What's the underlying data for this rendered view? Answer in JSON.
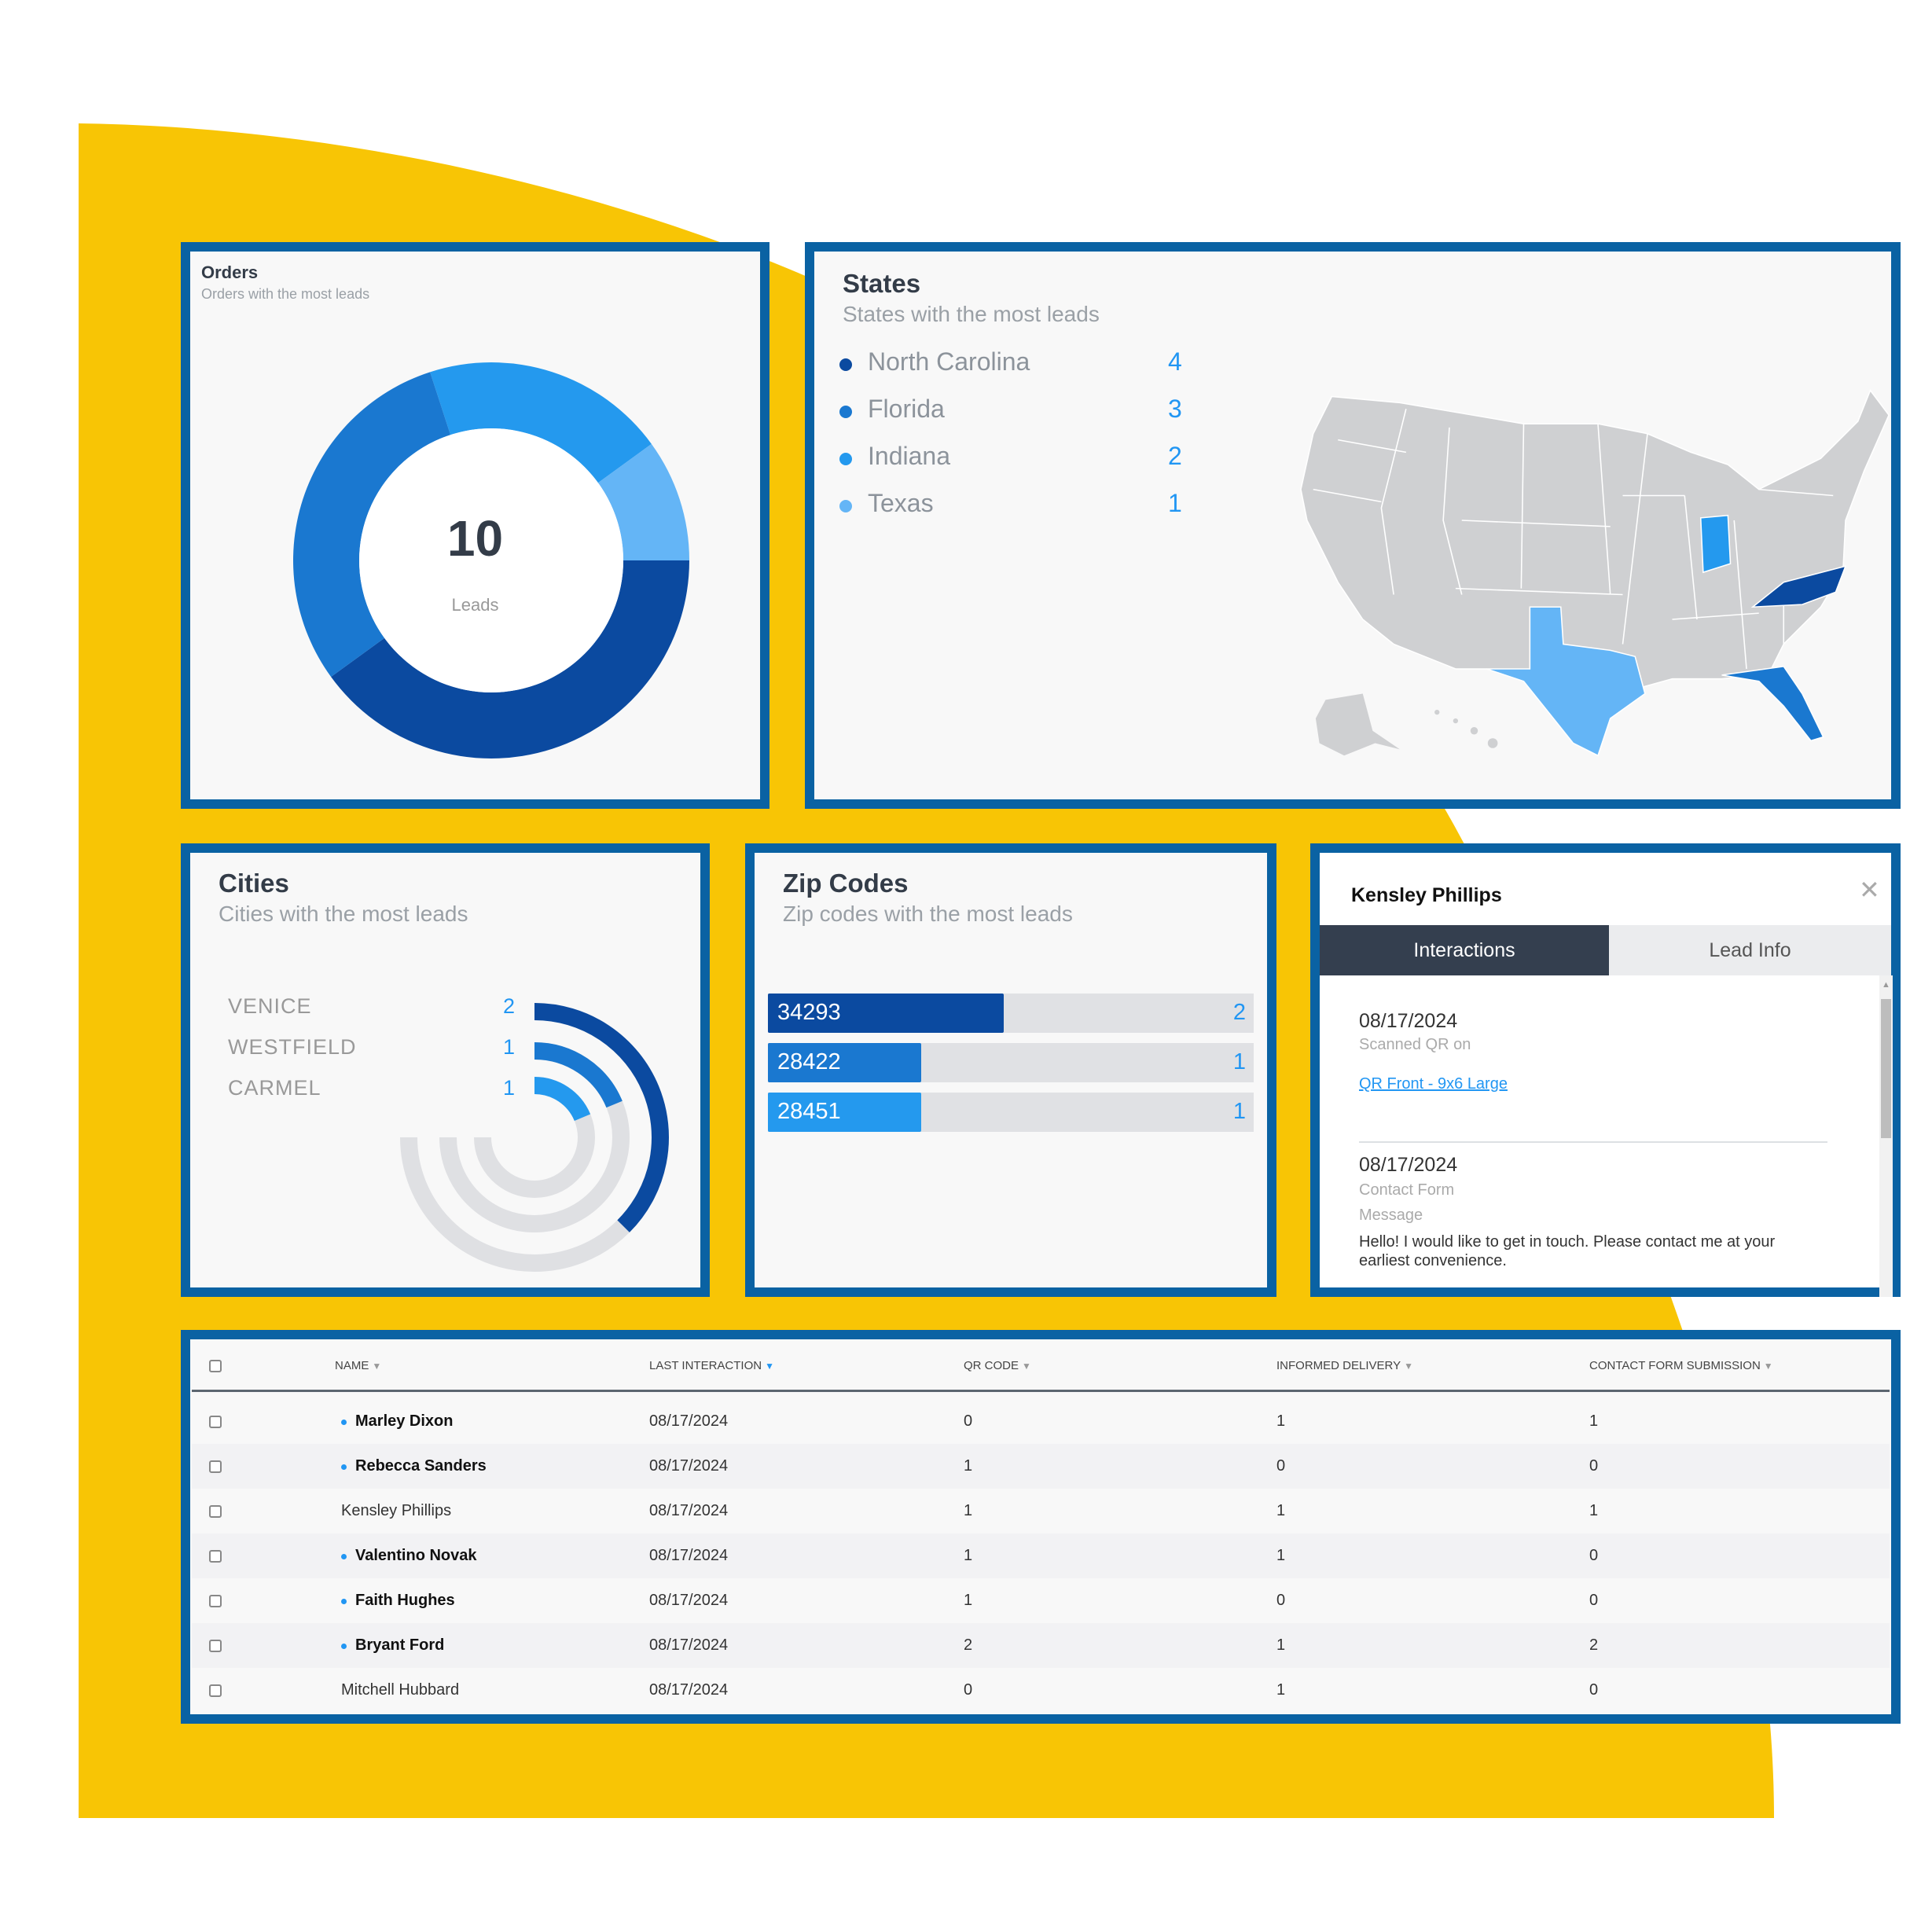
{
  "colors": {
    "border": "#0a62a3",
    "yellow": "#f8c505",
    "dark": "#0b4aa0",
    "mid": "#1a78d0",
    "bright": "#2499ee",
    "light": "#64b5f6",
    "gray": "#cfd0d2"
  },
  "orders": {
    "title": "Orders",
    "subtitle": "Orders with the most leads",
    "total": "10",
    "total_label": "Leads"
  },
  "states": {
    "title": "States",
    "subtitle": "States with the most leads",
    "items": [
      {
        "name": "North Carolina",
        "value": "4",
        "color": "#0b4aa0"
      },
      {
        "name": "Florida",
        "value": "3",
        "color": "#1a78d0"
      },
      {
        "name": "Indiana",
        "value": "2",
        "color": "#2499ee"
      },
      {
        "name": "Texas",
        "value": "1",
        "color": "#64b5f6"
      }
    ]
  },
  "cities": {
    "title": "Cities",
    "subtitle": "Cities with the most leads",
    "items": [
      {
        "name": "VENICE",
        "value": "2"
      },
      {
        "name": "WESTFIELD",
        "value": "1"
      },
      {
        "name": "CARMEL",
        "value": "1"
      }
    ]
  },
  "zips": {
    "title": "Zip Codes",
    "subtitle": "Zip codes with the most leads",
    "items": [
      {
        "code": "34293",
        "value": "2",
        "color": "#0b4aa0"
      },
      {
        "code": "28422",
        "value": "1",
        "color": "#1a78d0"
      },
      {
        "code": "28451",
        "value": "1",
        "color": "#2499ee"
      }
    ]
  },
  "lead": {
    "name": "Kensley Phillips",
    "close_icon": "close-icon",
    "tabs": [
      "Interactions",
      "Lead Info"
    ],
    "interactions": [
      {
        "date": "08/17/2024",
        "type": "Scanned QR on",
        "link": "QR Front - 9x6 Large"
      },
      {
        "date": "08/17/2024",
        "type": "Contact Form",
        "label": "Message",
        "message": "Hello! I would like to get in touch. Please contact me at your earliest convenience."
      }
    ]
  },
  "table": {
    "headers": [
      "NAME",
      "LAST INTERACTION",
      "QR CODE",
      "INFORMED DELIVERY",
      "CONTACT FORM SUBMISSION"
    ],
    "rows": [
      {
        "name": "Marley Dixon",
        "unread": true,
        "last": "08/17/2024",
        "qr": "0",
        "informed": "1",
        "contact": "1"
      },
      {
        "name": "Rebecca Sanders",
        "unread": true,
        "last": "08/17/2024",
        "qr": "1",
        "informed": "0",
        "contact": "0"
      },
      {
        "name": "Kensley Phillips",
        "unread": false,
        "last": "08/17/2024",
        "qr": "1",
        "informed": "1",
        "contact": "1"
      },
      {
        "name": "Valentino Novak",
        "unread": true,
        "last": "08/17/2024",
        "qr": "1",
        "informed": "1",
        "contact": "0"
      },
      {
        "name": "Faith Hughes",
        "unread": true,
        "last": "08/17/2024",
        "qr": "1",
        "informed": "0",
        "contact": "0"
      },
      {
        "name": "Bryant Ford",
        "unread": true,
        "last": "08/17/2024",
        "qr": "2",
        "informed": "1",
        "contact": "2"
      },
      {
        "name": "Mitchell Hubbard",
        "unread": false,
        "last": "08/17/2024",
        "qr": "0",
        "informed": "1",
        "contact": "0"
      }
    ]
  },
  "chart_data": [
    {
      "type": "pie",
      "variant": "donut",
      "values": [
        2,
        1,
        4,
        3
      ],
      "colors": [
        "#2499ee",
        "#64b5f6",
        "#0b4aa0",
        "#1a78d0"
      ],
      "center_label": "10 Leads"
    },
    {
      "type": "bar",
      "variant": "radial",
      "categories": [
        "VENICE",
        "WESTFIELD",
        "CARMEL"
      ],
      "values": [
        2,
        1,
        1
      ]
    },
    {
      "type": "bar",
      "orientation": "horizontal",
      "categories": [
        "34293",
        "28422",
        "28451"
      ],
      "values": [
        2,
        1,
        1
      ]
    }
  ]
}
